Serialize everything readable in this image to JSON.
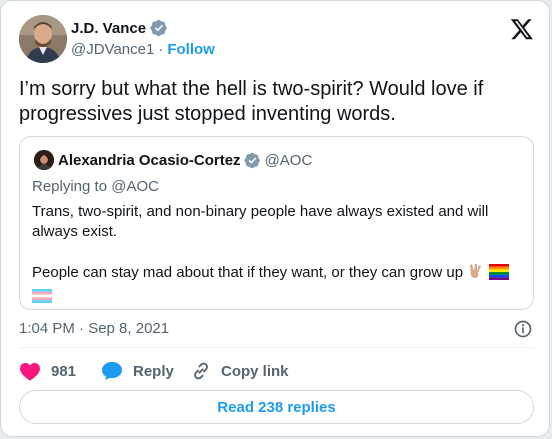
{
  "author": {
    "name": "J.D. Vance",
    "handle": "@JDVance1",
    "separator": "·",
    "follow_label": "Follow",
    "verified_color": "#829aab"
  },
  "icons": {
    "brand": "x-logo-icon",
    "verified": "verified-badge-icon",
    "info": "info-icon",
    "like": "heart-icon",
    "reply": "reply-bubble-icon",
    "copy_link": "link-icon"
  },
  "tweet": {
    "text": "I’m sorry but what the hell is two-spirit? Would love if progressives just stopped inventing words."
  },
  "quote": {
    "name": "Alexandria Ocasio-Cortez",
    "handle": "@AOC",
    "replying_to": "Replying to @AOC",
    "paragraph1": "Trans, two-spirit, and non-binary people have always existed and will always exist.",
    "paragraph2": "People can stay mad about that if they want, or they can grow up",
    "emojis": [
      "victory-hand-emoji",
      "rainbow-flag-emoji",
      "transgender-flag-emoji"
    ]
  },
  "meta": {
    "timestamp": "1:04 PM · Sep 8, 2021"
  },
  "actions": {
    "like_count": "981",
    "reply_label": "Reply",
    "copy_link_label": "Copy link"
  },
  "read_replies_label": "Read 238 replies",
  "colors": {
    "accent": "#1d9bf0",
    "like": "#f91880",
    "text": "#0f1419",
    "secondary": "#536471",
    "border": "#cfd9de"
  }
}
